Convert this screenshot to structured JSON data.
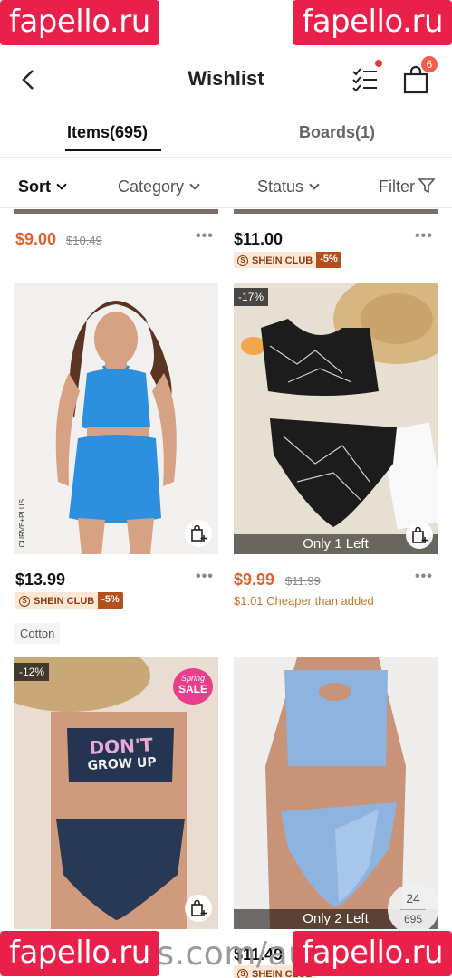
{
  "watermarks": {
    "brand": "fapello.ru",
    "footer": "us.com/au"
  },
  "header": {
    "title": "Wishlist",
    "bag_count": "6"
  },
  "tabs": [
    {
      "label": "Items(695)"
    },
    {
      "label": "Boards(1)"
    }
  ],
  "filters": {
    "sort": "Sort",
    "category": "Category",
    "status": "Status",
    "filter": "Filter"
  },
  "products": [
    {
      "price": "$9.00",
      "old_price": "$10.49"
    },
    {
      "price": "$11.00",
      "club_name": "SHEIN CLUB",
      "club_off": "-5%"
    },
    {
      "price": "$13.99",
      "club_name": "SHEIN CLUB",
      "club_off": "-5%",
      "tag": "Cotton",
      "curve_label": "CURVE+PLUS"
    },
    {
      "price": "$9.99",
      "old_price": "$11.99",
      "discount": "-17%",
      "stock": "Only 1 Left",
      "note": "$1.01 Cheaper than added"
    },
    {
      "discount": "-12%",
      "promo_top": "Spring",
      "promo_bottom": "SALE",
      "print_line1": "DON'T",
      "print_line2": "GROW UP"
    },
    {
      "stock": "Only 2 Left",
      "price": "$11.49",
      "club_name": "SHEIN CLUB"
    }
  ],
  "page_counter": {
    "current": "24",
    "total": "695"
  },
  "colors": {
    "sale": "#e0612d",
    "club_bg": "#fde7d4",
    "club_off_bg": "#b4501c",
    "badge": "#f25f4c",
    "watermark": "#e8204a"
  },
  "icons": [
    "back-icon",
    "list-icon",
    "bag-icon",
    "chevron-down-icon",
    "funnel-icon",
    "add-to-cart-icon"
  ]
}
